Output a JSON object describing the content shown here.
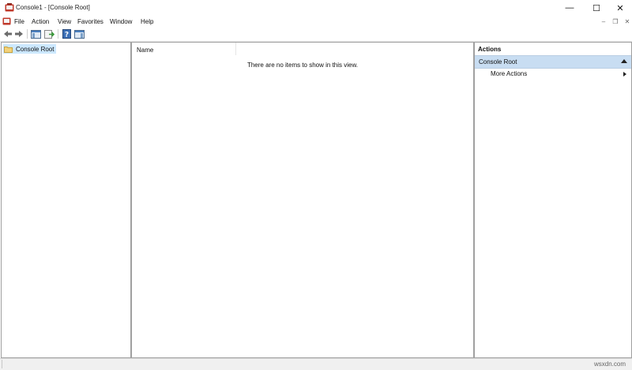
{
  "window": {
    "title": "Console1 - [Console Root]",
    "controls": {
      "minimize": "—",
      "maximize": "☐",
      "close": "✕"
    }
  },
  "menubar": {
    "items": [
      "File",
      "Action",
      "View",
      "Favorites",
      "Window",
      "Help"
    ],
    "mdi_controls": {
      "minimize": "–",
      "restore": "❐",
      "close": "✕"
    }
  },
  "toolbar": {
    "buttons": [
      "back-arrow-icon",
      "forward-arrow-icon",
      "show-hide-tree-icon",
      "export-list-icon",
      "help-icon",
      "show-hide-action-pane-icon"
    ]
  },
  "tree": {
    "nodes": [
      {
        "label": "Console Root",
        "selected": true
      }
    ]
  },
  "list": {
    "columns": [
      "Name"
    ],
    "empty_message": "There are no items to show in this view."
  },
  "actions": {
    "title": "Actions",
    "section": "Console Root",
    "items": [
      {
        "label": "More Actions",
        "has_submenu": true
      }
    ]
  },
  "watermark": "wsxdn.com",
  "colors": {
    "selection": "#cce8ff",
    "actions_section": "#c8ddf2",
    "app_icon_red": "#c0392b"
  }
}
